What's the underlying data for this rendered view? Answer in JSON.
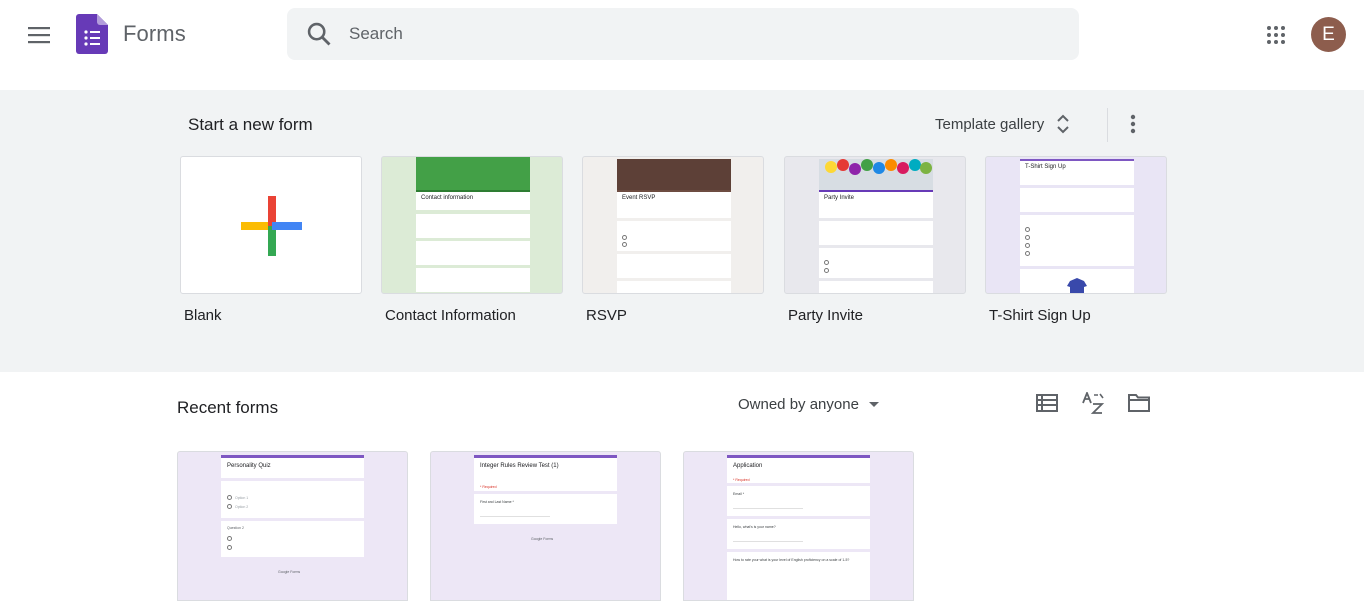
{
  "header": {
    "app_title": "Forms",
    "search_placeholder": "Search",
    "avatar_letter": "E",
    "brand_color": "#673ab7",
    "avatar_color": "#8d5d4d",
    "icons": [
      "menu-icon",
      "forms-logo-icon",
      "search-icon",
      "apps-grid-icon"
    ]
  },
  "templates": {
    "section_title": "Start a new form",
    "gallery_label": "Template gallery",
    "items": [
      {
        "label": "Blank"
      },
      {
        "label": "Contact Information",
        "preview_title": "Contact information"
      },
      {
        "label": "RSVP",
        "preview_title": "Event RSVP"
      },
      {
        "label": "Party Invite",
        "preview_title": "Party Invite"
      },
      {
        "label": "T-Shirt Sign Up",
        "preview_title": "T-Shirt Sign Up"
      }
    ]
  },
  "recent": {
    "section_title": "Recent forms",
    "owner_filter": "Owned by anyone",
    "icons": [
      "list-view-icon",
      "sort-az-icon",
      "folder-icon"
    ],
    "items": [
      {
        "preview_title": "Personality Quiz",
        "q1": "Option 1",
        "q2": "Option 2",
        "section2": "Question 2",
        "footer": "Google Forms"
      },
      {
        "preview_title": "Integer Rules Review Test (1)",
        "required": "* Required",
        "q1": "First and Last Name *",
        "footer": "Google Forms"
      },
      {
        "preview_title": "Application",
        "required": "* Required",
        "q1": "Email *",
        "q2": "Hello, what's is your name?",
        "q3": "How to rate your what is your level of English proficiency on a scale of 1-5?"
      }
    ]
  }
}
